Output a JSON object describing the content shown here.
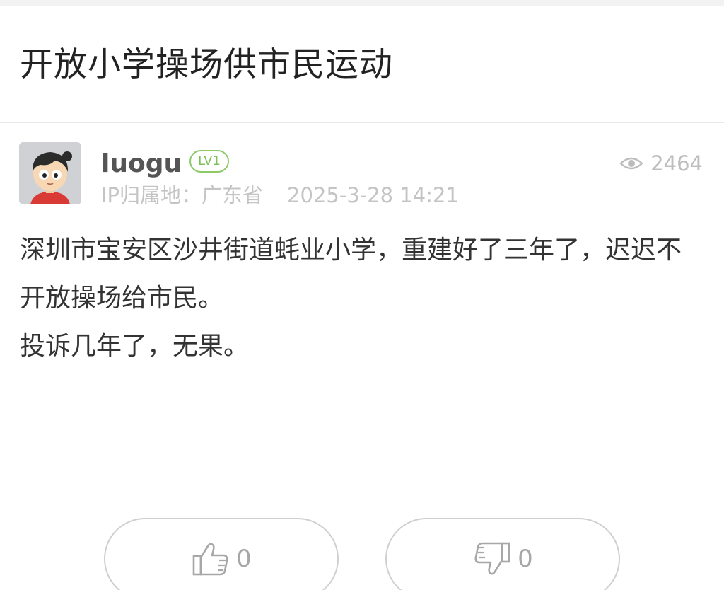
{
  "post": {
    "title": "开放小学操场供市民运动",
    "author": {
      "name": "luogu",
      "level": "LV1"
    },
    "ip_location": "IP归属地：广东省",
    "time": "2025-3-28 14:21",
    "views": "2464",
    "content": [
      "深圳市宝安区沙井街道蚝业小学，重建好了三年了，迟迟不开放操场给市民。",
      "投诉几年了，无果。"
    ]
  },
  "actions": {
    "like_count": "0",
    "dislike_count": "0"
  },
  "icons": {
    "views": "eye-icon",
    "like": "thumbs-up-icon",
    "dislike": "thumbs-down-icon"
  },
  "colors": {
    "level_badge": "#7fbf5a",
    "meta_text": "#c4c4c4",
    "title_text": "#222222"
  }
}
